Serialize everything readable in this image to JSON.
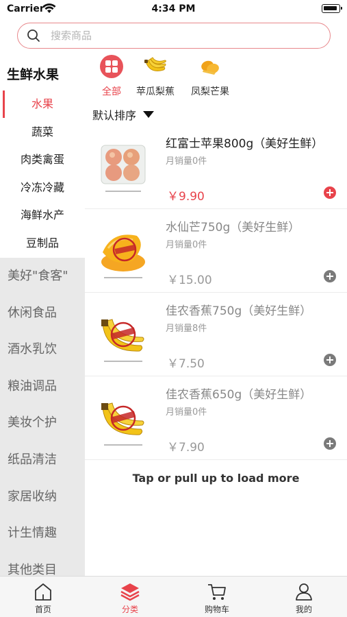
{
  "status_bar": {
    "carrier": "Carrier",
    "time": "4:34 PM"
  },
  "search": {
    "placeholder": "搜索商品"
  },
  "sidebar": {
    "title": "生鲜水果",
    "sub_items": [
      {
        "label": "水果"
      },
      {
        "label": "蔬菜"
      },
      {
        "label": "肉类禽蛋"
      },
      {
        "label": "冷冻冷藏"
      },
      {
        "label": "海鲜水产"
      },
      {
        "label": "豆制品"
      }
    ],
    "active_sub_index": 0,
    "categories": [
      {
        "label": "美好\"食客\""
      },
      {
        "label": "休闲食品"
      },
      {
        "label": "酒水乳饮"
      },
      {
        "label": "粮油调品"
      },
      {
        "label": "美妆个护"
      },
      {
        "label": "纸品清洁"
      },
      {
        "label": "家居收纳"
      },
      {
        "label": "计生情趣"
      },
      {
        "label": "其他类目"
      }
    ]
  },
  "filters": {
    "chips": [
      {
        "label": "全部",
        "icon": "grid-icon",
        "active": true
      },
      {
        "label": "苹瓜梨蕉",
        "icon": "banana-icon",
        "active": false
      },
      {
        "label": "凤梨芒果",
        "icon": "mango-icon",
        "active": false
      }
    ],
    "sort_label": "默认排序"
  },
  "products": [
    {
      "name": "红富士苹果800g（美好生鲜）",
      "sales": "月销量0件",
      "price": "￥9.90",
      "image": "apple-pack"
    },
    {
      "name": "水仙芒750g（美好生鲜）",
      "sales": "月销量0件",
      "price": "￥15.00",
      "image": "mango"
    },
    {
      "name": "佳农香蕉750g（美好生鲜）",
      "sales": "月销量8件",
      "price": "￥7.50",
      "image": "banana"
    },
    {
      "name": "佳农香蕉650g（美好生鲜）",
      "sales": "月销量0件",
      "price": "￥7.90",
      "image": "banana"
    }
  ],
  "load_more": "Tap or pull up to load more",
  "tab_bar": {
    "tabs": [
      {
        "label": "首页",
        "icon": "home-icon",
        "active": false
      },
      {
        "label": "分类",
        "icon": "layers-icon",
        "active": true
      },
      {
        "label": "购物车",
        "icon": "cart-icon",
        "active": false
      },
      {
        "label": "我的",
        "icon": "user-icon",
        "active": false
      }
    ]
  },
  "colors": {
    "accent": "#e8434b",
    "sidebar_bg": "#e9e9e9",
    "search_border": "#e8878b"
  }
}
